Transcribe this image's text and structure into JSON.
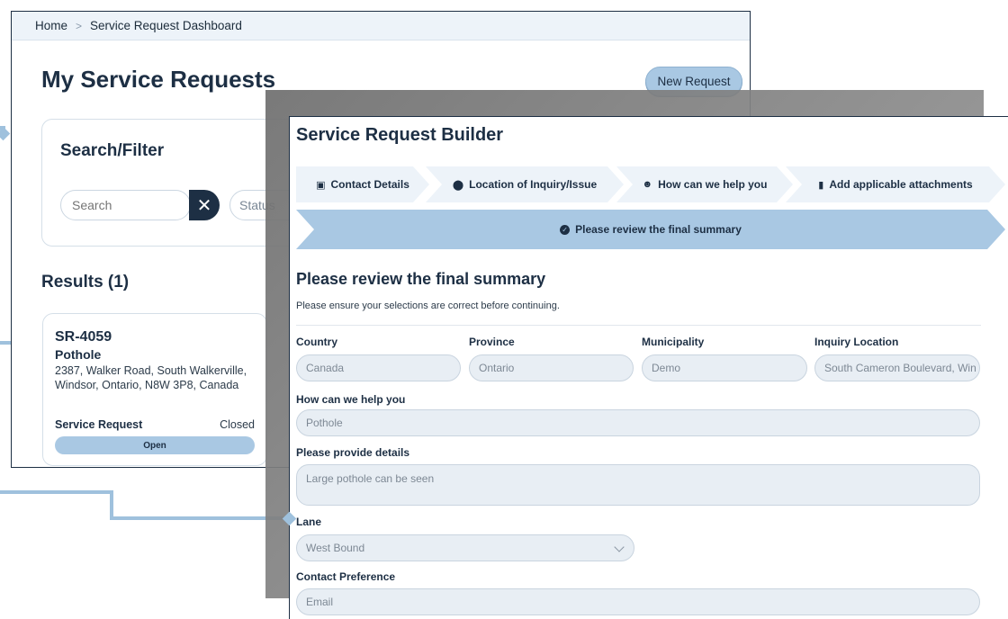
{
  "dashboard": {
    "breadcrumb": {
      "home": "Home",
      "current": "Service Request Dashboard"
    },
    "title": "My Service Requests",
    "new_request_label": "New Request",
    "filter": {
      "title": "Search/Filter",
      "search_placeholder": "Search",
      "status_placeholder": "Status"
    },
    "results_title": "Results (1)",
    "card": {
      "id": "SR-4059",
      "type": "Pothole",
      "address": "2387, Walker Road, South Walkerville, Windsor, Ontario, N8W 3P8, Canada",
      "service_label": "Service Request",
      "status_value": "Closed",
      "pill_label": "Open"
    }
  },
  "builder": {
    "title": "Service Request Builder",
    "steps": [
      {
        "label": "Contact Details",
        "icon": "id-card-icon"
      },
      {
        "label": "Location of Inquiry/Issue",
        "icon": "map-pin-icon"
      },
      {
        "label": "How can we help you",
        "icon": "person-help-icon"
      },
      {
        "label": "Add applicable attachments",
        "icon": "file-icon"
      }
    ],
    "active_step": {
      "label": "Please review the final summary",
      "icon": "check-circle-icon"
    },
    "section_title": "Please review the final summary",
    "section_subtitle": "Please ensure your selections are correct before continuing.",
    "fields": {
      "country": {
        "label": "Country",
        "value": "Canada"
      },
      "province": {
        "label": "Province",
        "value": "Ontario"
      },
      "municipality": {
        "label": "Municipality",
        "value": "Demo"
      },
      "inquiry_location": {
        "label": "Inquiry Location",
        "value": "South Cameron Boulevard, Win"
      },
      "help": {
        "label": "How can we help you",
        "value": "Pothole"
      },
      "details": {
        "label": "Please provide details",
        "value": "Large pothole can be seen"
      },
      "lane": {
        "label": "Lane",
        "value": "West Bound"
      },
      "contact": {
        "label": "Contact Preference",
        "value": "Email"
      }
    }
  },
  "colors": {
    "accent": "#a9c8e3",
    "navy": "#1d2f44",
    "connector": "#9fc1dd"
  }
}
